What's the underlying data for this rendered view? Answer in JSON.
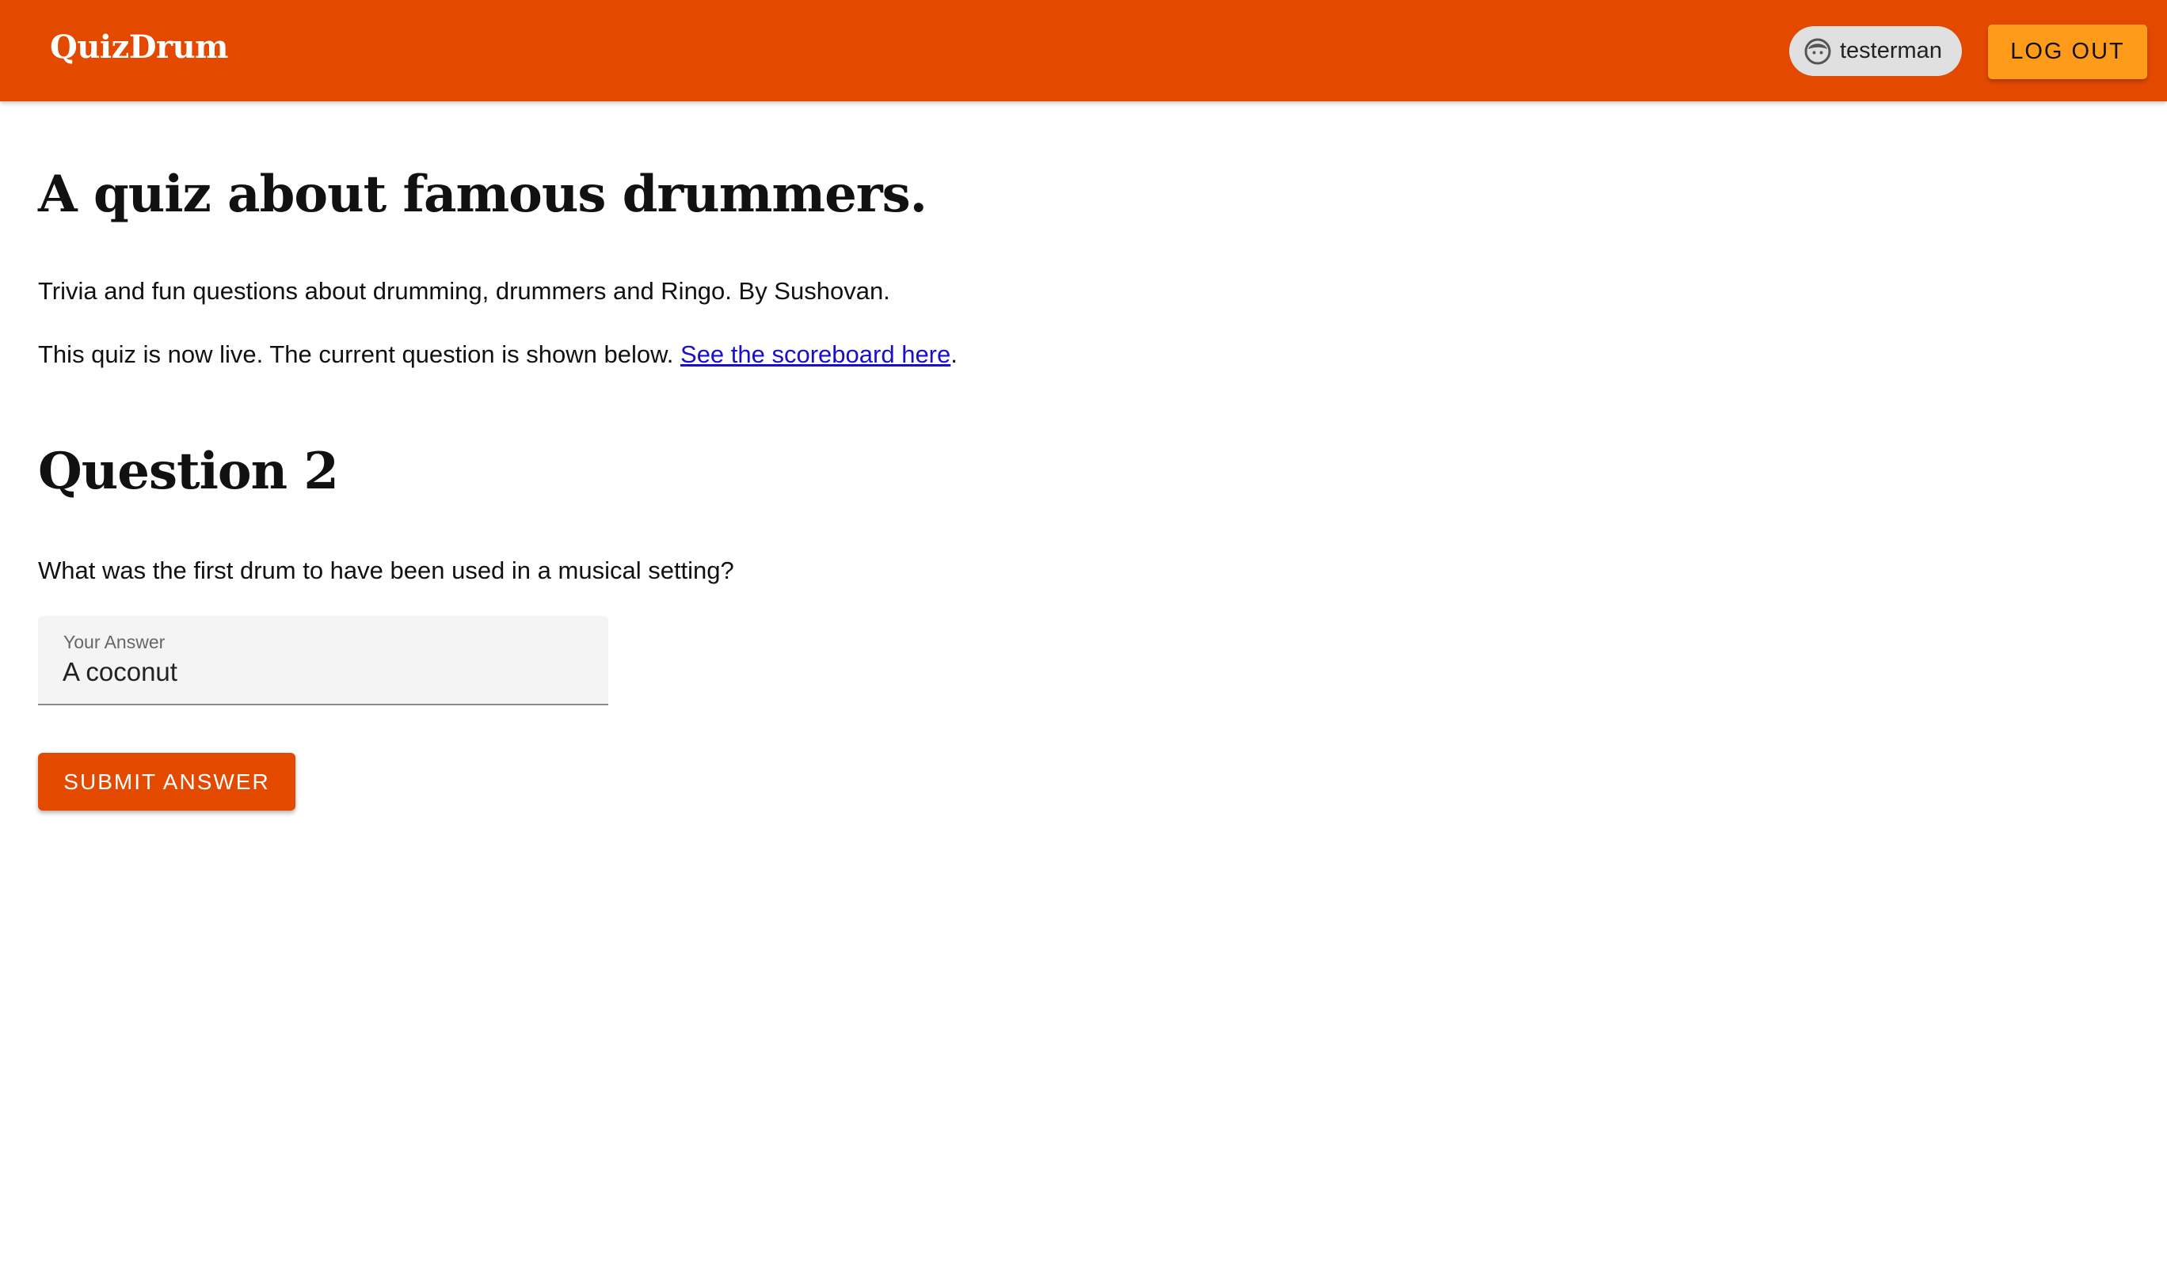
{
  "header": {
    "brand": "QuizDrum",
    "user": {
      "username": "testerman",
      "avatar_icon": "face-icon"
    },
    "logout_label": "Log Out"
  },
  "quiz": {
    "title": "A quiz about famous drummers.",
    "description": "Trivia and fun questions about drumming, drummers and Ringo. By Sushovan.",
    "status_text": "This quiz is now live. The current question is shown below.",
    "scoreboard_link": "See the scoreboard here",
    "status_suffix": "."
  },
  "question": {
    "heading": "Question 2",
    "text": "What was the first drum to have been used in a musical setting?",
    "answer_field": {
      "label": "Your Answer",
      "value": "A coconut"
    },
    "submit_label": "Submit Answer"
  },
  "colors": {
    "primary": "#e34a00",
    "accent": "#ff9b1a",
    "link": "#1a0dcc"
  }
}
